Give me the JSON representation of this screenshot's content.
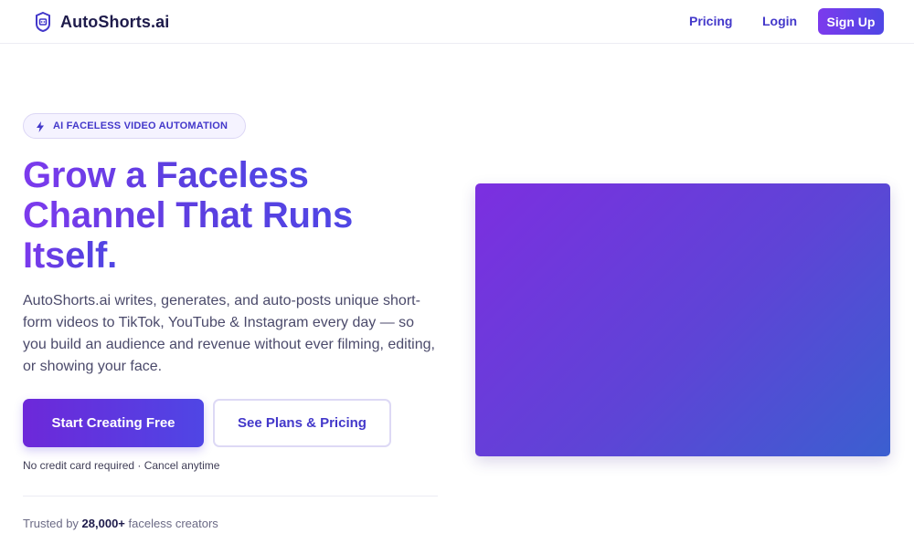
{
  "nav": {
    "brand": "AutoShorts.ai",
    "logo_icon": "robot-face-icon",
    "links": {
      "pricing": "Pricing",
      "login": "Login"
    },
    "signup": "Sign Up"
  },
  "hero": {
    "badge": {
      "icon": "lightning-icon",
      "text": "AI FACELESS VIDEO AUTOMATION"
    },
    "headline": [
      "Grow a Faceless",
      "Channel That Runs",
      "Itself."
    ],
    "subtext": "AutoShorts.ai writes, generates, and auto-posts unique short-form videos to TikTok, YouTube & Instagram every day — so you build an audience and revenue without ever filming, editing, or showing your face.",
    "cta_primary": "Start Creating Free",
    "cta_secondary": "See Plans & Pricing",
    "note": "No credit card required · Cancel anytime",
    "trust": {
      "prefix": "Trusted by ",
      "count": "28,000+",
      "suffix": " faceless creators"
    }
  },
  "colors": {
    "accent": "#4f46e5",
    "brand_purple": "#7c3aed",
    "text_dark": "#1e1b4b"
  }
}
